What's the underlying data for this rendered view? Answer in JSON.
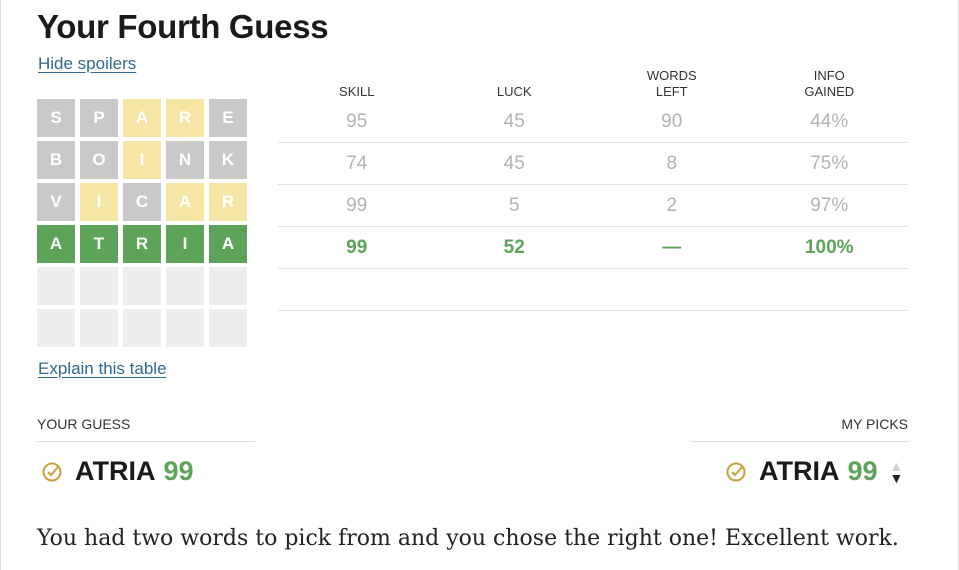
{
  "header": {
    "title": "Your Fourth Guess",
    "hide_spoilers": "Hide spoilers",
    "explain_table": "Explain this table"
  },
  "grid": [
    [
      {
        "l": "S",
        "s": "absent"
      },
      {
        "l": "P",
        "s": "absent"
      },
      {
        "l": "A",
        "s": "present"
      },
      {
        "l": "R",
        "s": "present"
      },
      {
        "l": "E",
        "s": "absent"
      }
    ],
    [
      {
        "l": "B",
        "s": "absent"
      },
      {
        "l": "O",
        "s": "absent"
      },
      {
        "l": "I",
        "s": "present"
      },
      {
        "l": "N",
        "s": "absent"
      },
      {
        "l": "K",
        "s": "absent"
      }
    ],
    [
      {
        "l": "V",
        "s": "absent"
      },
      {
        "l": "I",
        "s": "present"
      },
      {
        "l": "C",
        "s": "absent"
      },
      {
        "l": "A",
        "s": "present"
      },
      {
        "l": "R",
        "s": "present"
      }
    ],
    [
      {
        "l": "A",
        "s": "correct"
      },
      {
        "l": "T",
        "s": "correct"
      },
      {
        "l": "R",
        "s": "correct"
      },
      {
        "l": "I",
        "s": "correct"
      },
      {
        "l": "A",
        "s": "correct"
      }
    ],
    [
      {
        "l": "",
        "s": "empty"
      },
      {
        "l": "",
        "s": "empty"
      },
      {
        "l": "",
        "s": "empty"
      },
      {
        "l": "",
        "s": "empty"
      },
      {
        "l": "",
        "s": "empty"
      }
    ],
    [
      {
        "l": "",
        "s": "empty"
      },
      {
        "l": "",
        "s": "empty"
      },
      {
        "l": "",
        "s": "empty"
      },
      {
        "l": "",
        "s": "empty"
      },
      {
        "l": "",
        "s": "empty"
      }
    ]
  ],
  "table": {
    "headers": [
      "SKILL",
      "LUCK",
      "WORDS LEFT",
      "INFO GAINED"
    ],
    "rows": [
      [
        "95",
        "45",
        "90",
        "44%"
      ],
      [
        "74",
        "45",
        "8",
        "75%"
      ],
      [
        "99",
        "5",
        "2",
        "97%"
      ],
      [
        "99",
        "52",
        "—",
        "100%"
      ]
    ]
  },
  "your_guess": {
    "label": "YOUR GUESS",
    "word": "ATRIA",
    "score": "99"
  },
  "my_picks": {
    "label": "MY PICKS",
    "word": "ATRIA",
    "score": "99"
  },
  "message": "You had two words to pick from and you chose the right one! Excellent work.",
  "colors": {
    "correct": "#5ea35a",
    "present": "#f5e6a6",
    "absent": "#c9c9c9",
    "link": "#326891"
  }
}
